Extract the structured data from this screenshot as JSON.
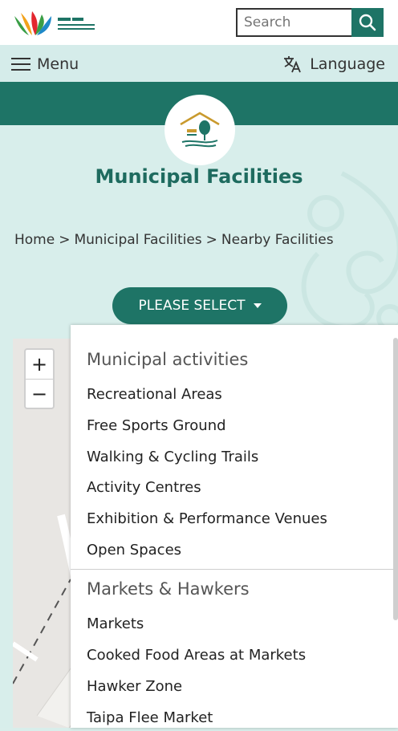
{
  "header": {
    "search_placeholder": "Search"
  },
  "nav": {
    "menu_label": "Menu",
    "language_label": "Language"
  },
  "hero": {
    "title": "Municipal Facilities"
  },
  "breadcrumb": [
    "Home",
    ">",
    "Municipal Facilities",
    ">",
    "Nearby Facilities"
  ],
  "select_button": {
    "label": "PLEASE SELECT"
  },
  "map_controls": {
    "zoom_in": "+",
    "zoom_out": "−"
  },
  "dropdown": {
    "groups": [
      {
        "title": "Municipal activities",
        "items": [
          "Recreational Areas",
          "Free Sports Ground",
          "Walking & Cycling Trails",
          "Activity Centres",
          "Exhibition & Performance Venues",
          "Open Spaces"
        ]
      },
      {
        "title": "Markets & Hawkers",
        "items": [
          "Markets",
          "Cooked Food Areas at Markets",
          "Hawker Zone",
          "Taipa Flee Market"
        ]
      }
    ]
  },
  "colors": {
    "brand_teal": "#1e7466",
    "background_mint": "#d8eeeb"
  }
}
